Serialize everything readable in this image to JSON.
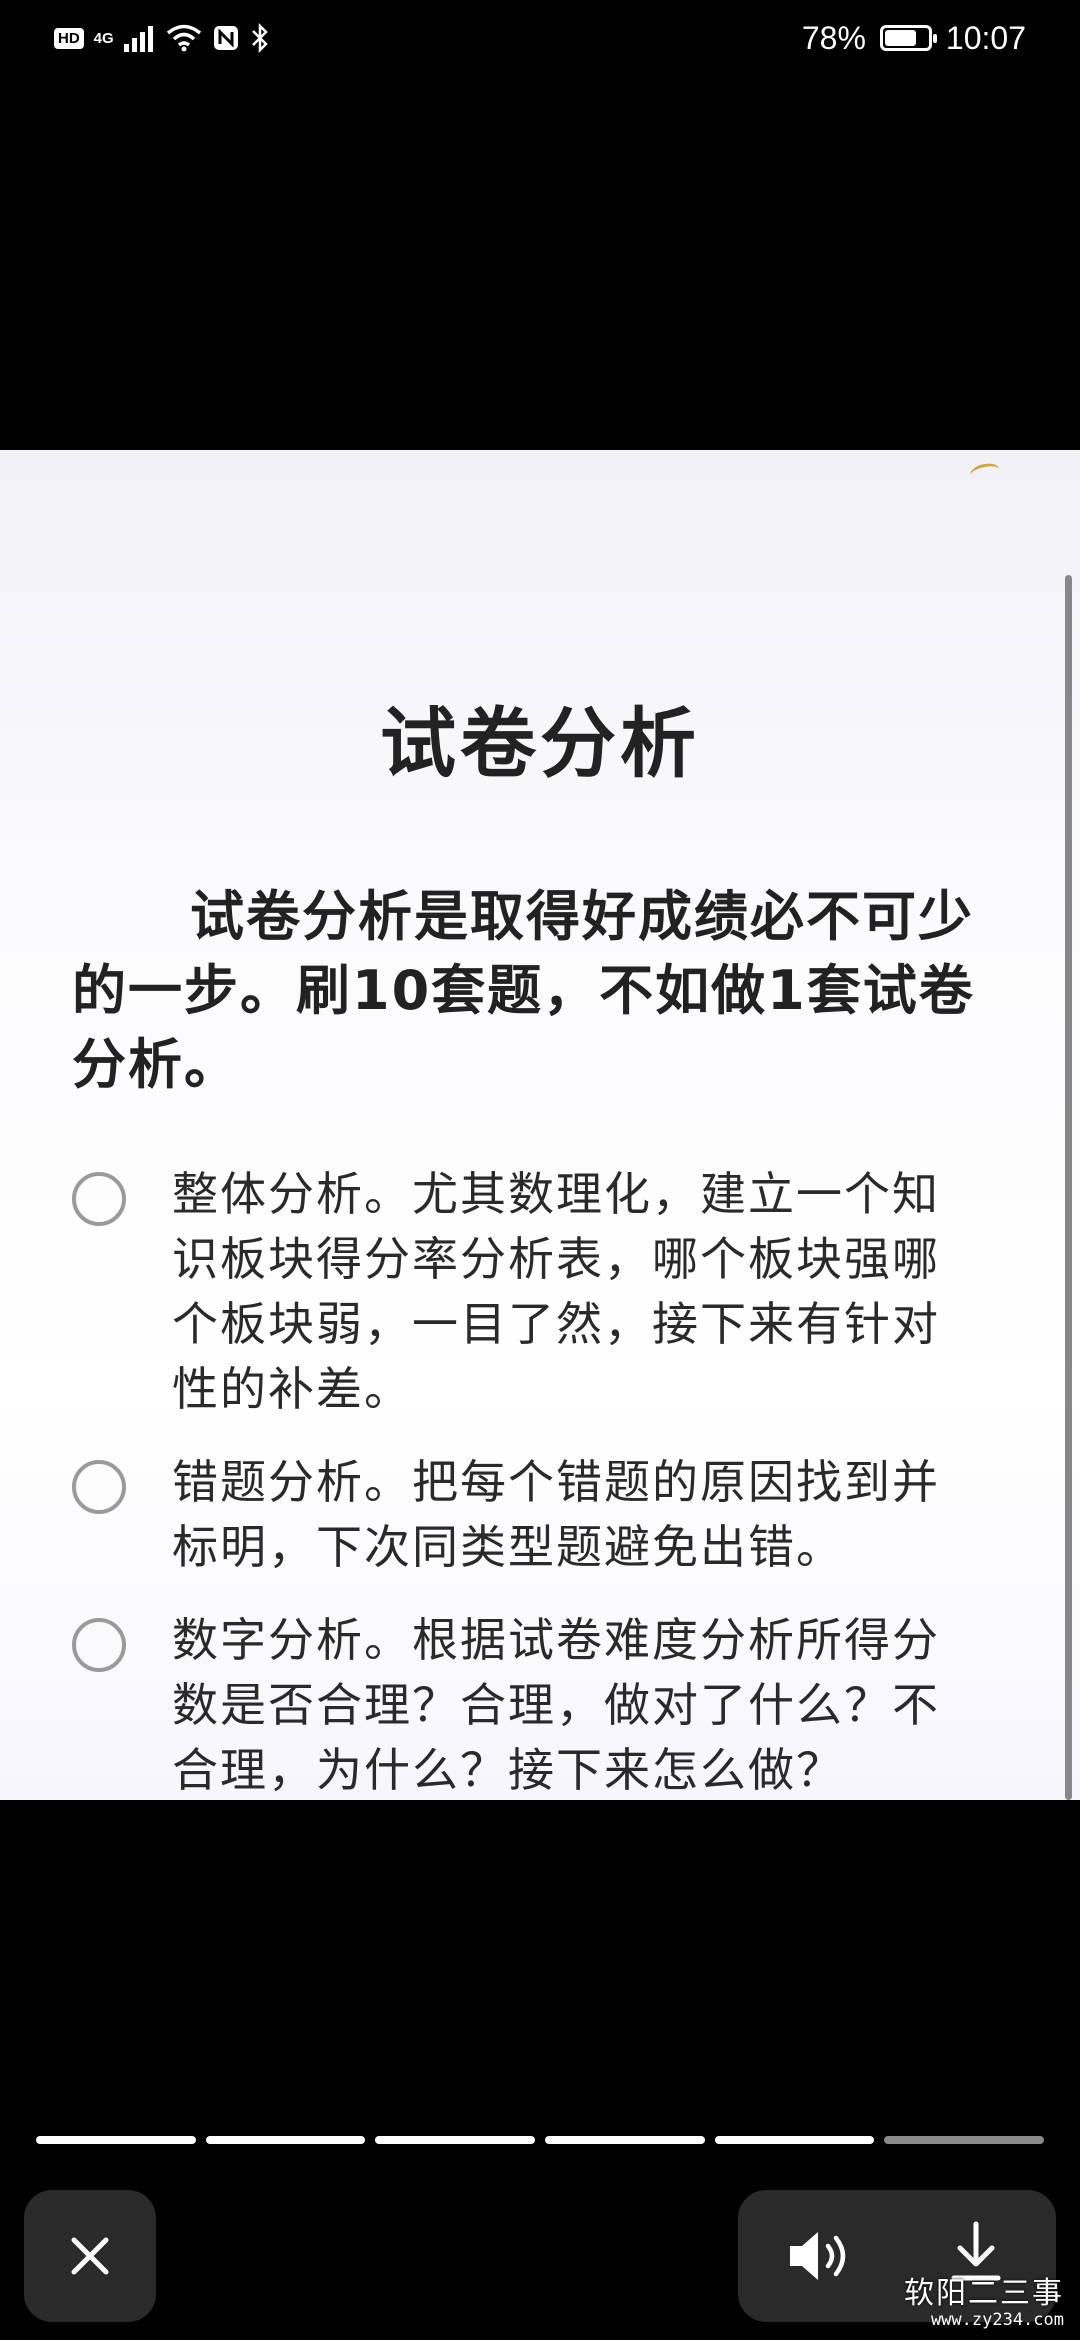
{
  "status_bar": {
    "hd": "HD",
    "network": "4G",
    "battery_percent": "78%",
    "battery_level": 0.78,
    "time": "10:07"
  },
  "card": {
    "title": "试卷分析",
    "intro": "试卷分析是取得好成绩必不可少的一步。刷10套题，不如做1套试卷分析。",
    "options": [
      {
        "text": "整体分析。尤其数理化，建立一个知识板块得分率分析表，哪个板块强哪个板块弱，一目了然，接下来有针对性的补差。"
      },
      {
        "text": "错题分析。把每个错题的原因找到并标明，下次同类型题避免出错。"
      },
      {
        "text": "数字分析。根据试卷难度分析所得分数是否合理？合理，做对了什么？不合理，为什么？接下来怎么做？"
      }
    ]
  },
  "story_progress": {
    "total_segments": 6,
    "viewed_segments": 5
  },
  "controls": {
    "close_icon": "close-icon",
    "sound_icon": "speaker-icon",
    "download_icon": "download-icon"
  },
  "watermark": {
    "text": "软阳二三事",
    "url": "www.zy234.com"
  },
  "colors": {
    "background": "#000000",
    "card_text": "#222222",
    "radio_border": "#9a9a9a",
    "progress_active": "#ffffff",
    "progress_inactive": "#8a8a8a"
  }
}
